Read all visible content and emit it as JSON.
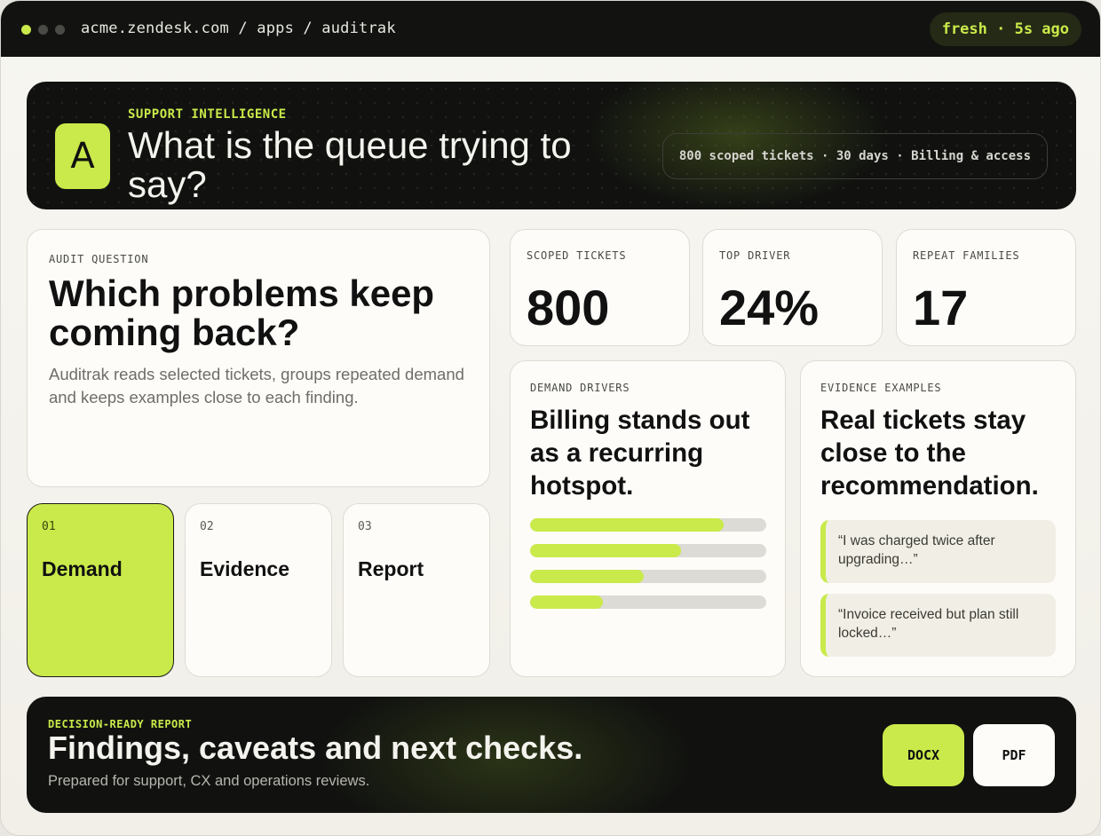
{
  "topbar": {
    "url": "acme.zendesk.com / apps / auditrak",
    "status": "fresh · 5s ago"
  },
  "hero": {
    "logo_letter": "A",
    "kicker": "SUPPORT INTELLIGENCE",
    "title": "What is the queue trying to say?",
    "scope_pill": "800 scoped tickets · 30 days · Billing & access"
  },
  "question": {
    "label": "AUDIT QUESTION",
    "title": "Which problems keep coming back?",
    "description": "Auditrak reads selected tickets, groups repeated demand and keeps examples close to each finding."
  },
  "stats": [
    {
      "label": "SCOPED TICKETS",
      "value": "800"
    },
    {
      "label": "TOP DRIVER",
      "value": "24%"
    },
    {
      "label": "REPEAT FAMILIES",
      "value": "17"
    }
  ],
  "steps": [
    {
      "num": "01",
      "name": "Demand",
      "active": true
    },
    {
      "num": "02",
      "name": "Evidence",
      "active": false
    },
    {
      "num": "03",
      "name": "Report",
      "active": false
    }
  ],
  "drivers": {
    "label": "DEMAND DRIVERS",
    "title": "Billing stands out as a recurring hotspot.",
    "bar_fractions": [
      0.82,
      0.64,
      0.48,
      0.31
    ]
  },
  "evidence": {
    "label": "EVIDENCE EXAMPLES",
    "title": "Real tickets stay close to the recommendation.",
    "quotes": [
      "“I was charged twice after upgrading…”",
      "“Invoice received but plan still locked…”"
    ]
  },
  "report": {
    "kicker": "DECISION-READY REPORT",
    "title": "Findings, caveats and next checks.",
    "subtitle": "Prepared for support, CX and operations reviews.",
    "docx_label": "DOCX",
    "pdf_label": "PDF"
  },
  "colors": {
    "accent": "#c9ea4a",
    "dark": "#111210",
    "card": "#fdfcf8"
  }
}
